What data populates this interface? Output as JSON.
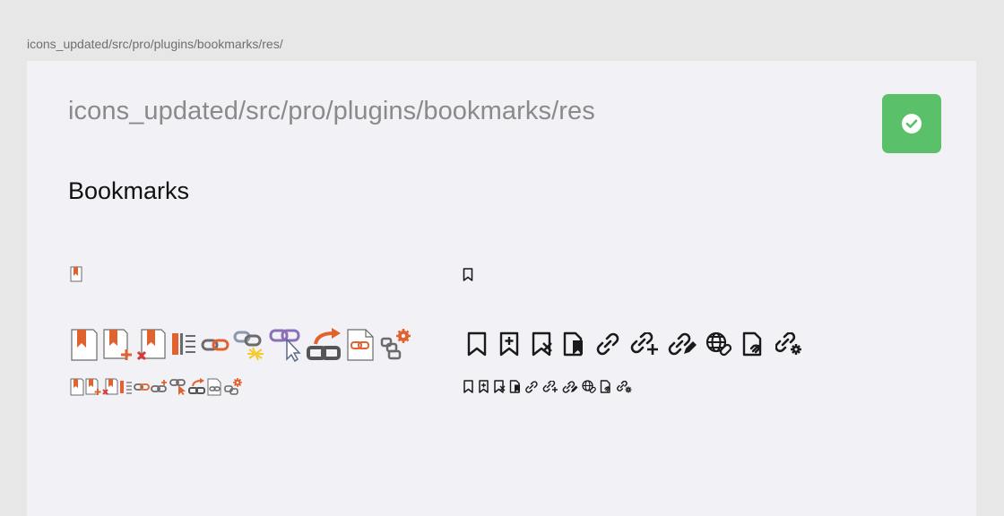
{
  "path_label": "icons_updated/src/pro/plugins/bookmarks/res/",
  "card": {
    "title": "icons_updated/src/pro/plugins/bookmarks/res",
    "status_icon": "check-circle-icon",
    "status_color": "#5ac06a"
  },
  "section": {
    "title": "Bookmarks"
  },
  "colors": {
    "legacy_accent": "#e0622f",
    "legacy_gray": "#6b6b6b",
    "modern_stroke": "#1a1a1a"
  },
  "icon_sets": {
    "legacy": [
      "bookmark-icon",
      "bookmark-add-icon",
      "bookmark-remove-icon",
      "bookmark-list-icon",
      "link-icon",
      "link-highlight-icon",
      "link-select-icon",
      "link-goto-icon",
      "link-add-icon",
      "link-settings-icon"
    ],
    "modern": [
      "bookmark-icon",
      "bookmark-add-icon",
      "bookmark-remove-icon",
      "bookmark-document-icon",
      "link-icon",
      "link-add-icon",
      "link-edit-icon",
      "link-web-icon",
      "link-document-icon",
      "link-settings-icon"
    ]
  }
}
